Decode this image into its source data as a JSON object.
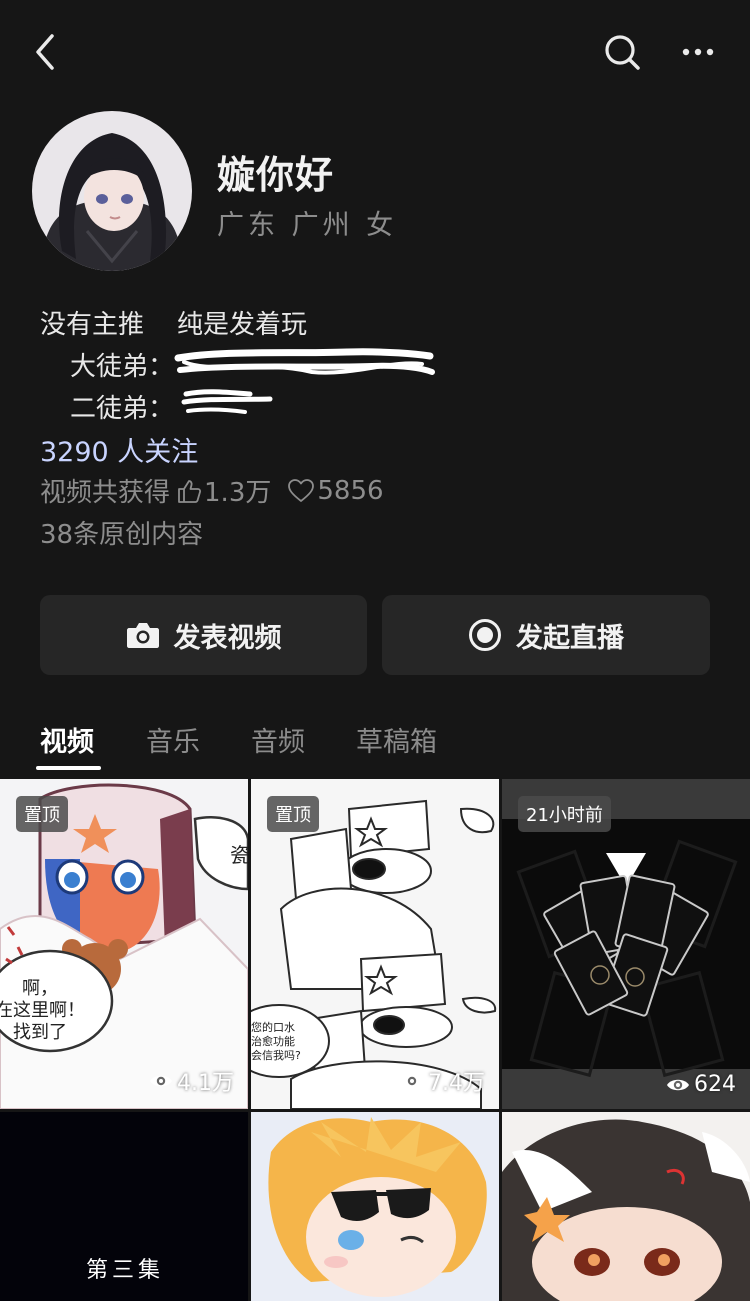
{
  "profile": {
    "nickname": "嫙你好",
    "location": "广东 广州 女",
    "bio_line1": "没有主推    纯是发着玩",
    "bio_line2_label": "大徒弟：",
    "bio_line3_label": "二徒弟：",
    "followers": "3290 人关注",
    "stats_prefix": "视频共获得",
    "likes": "1.3万",
    "favorites": "5856",
    "original_count": "38条原创内容"
  },
  "actions": {
    "post_label": "发表视频",
    "live_label": "发起直播"
  },
  "tabs": [
    {
      "label": "视频",
      "active": true
    },
    {
      "label": "音乐",
      "active": false
    },
    {
      "label": "音频",
      "active": false
    },
    {
      "label": "草稿箱",
      "active": false
    }
  ],
  "videos": [
    {
      "badge": "置顶",
      "views": "4.1万",
      "bubble": "啊，\n在这里啊！\n找到了",
      "side": "瓷"
    },
    {
      "badge": "置顶",
      "views": "7.4万",
      "bubble": "您的口水\n治愈功能\n会信我吗?"
    },
    {
      "badge": "21小时前",
      "views": "624"
    },
    {
      "title": "第三集"
    },
    {},
    {}
  ],
  "colors": {
    "background": "#161616",
    "button_bg": "#262626",
    "link": "#c9d4ff",
    "muted": "#8d8d8d"
  }
}
